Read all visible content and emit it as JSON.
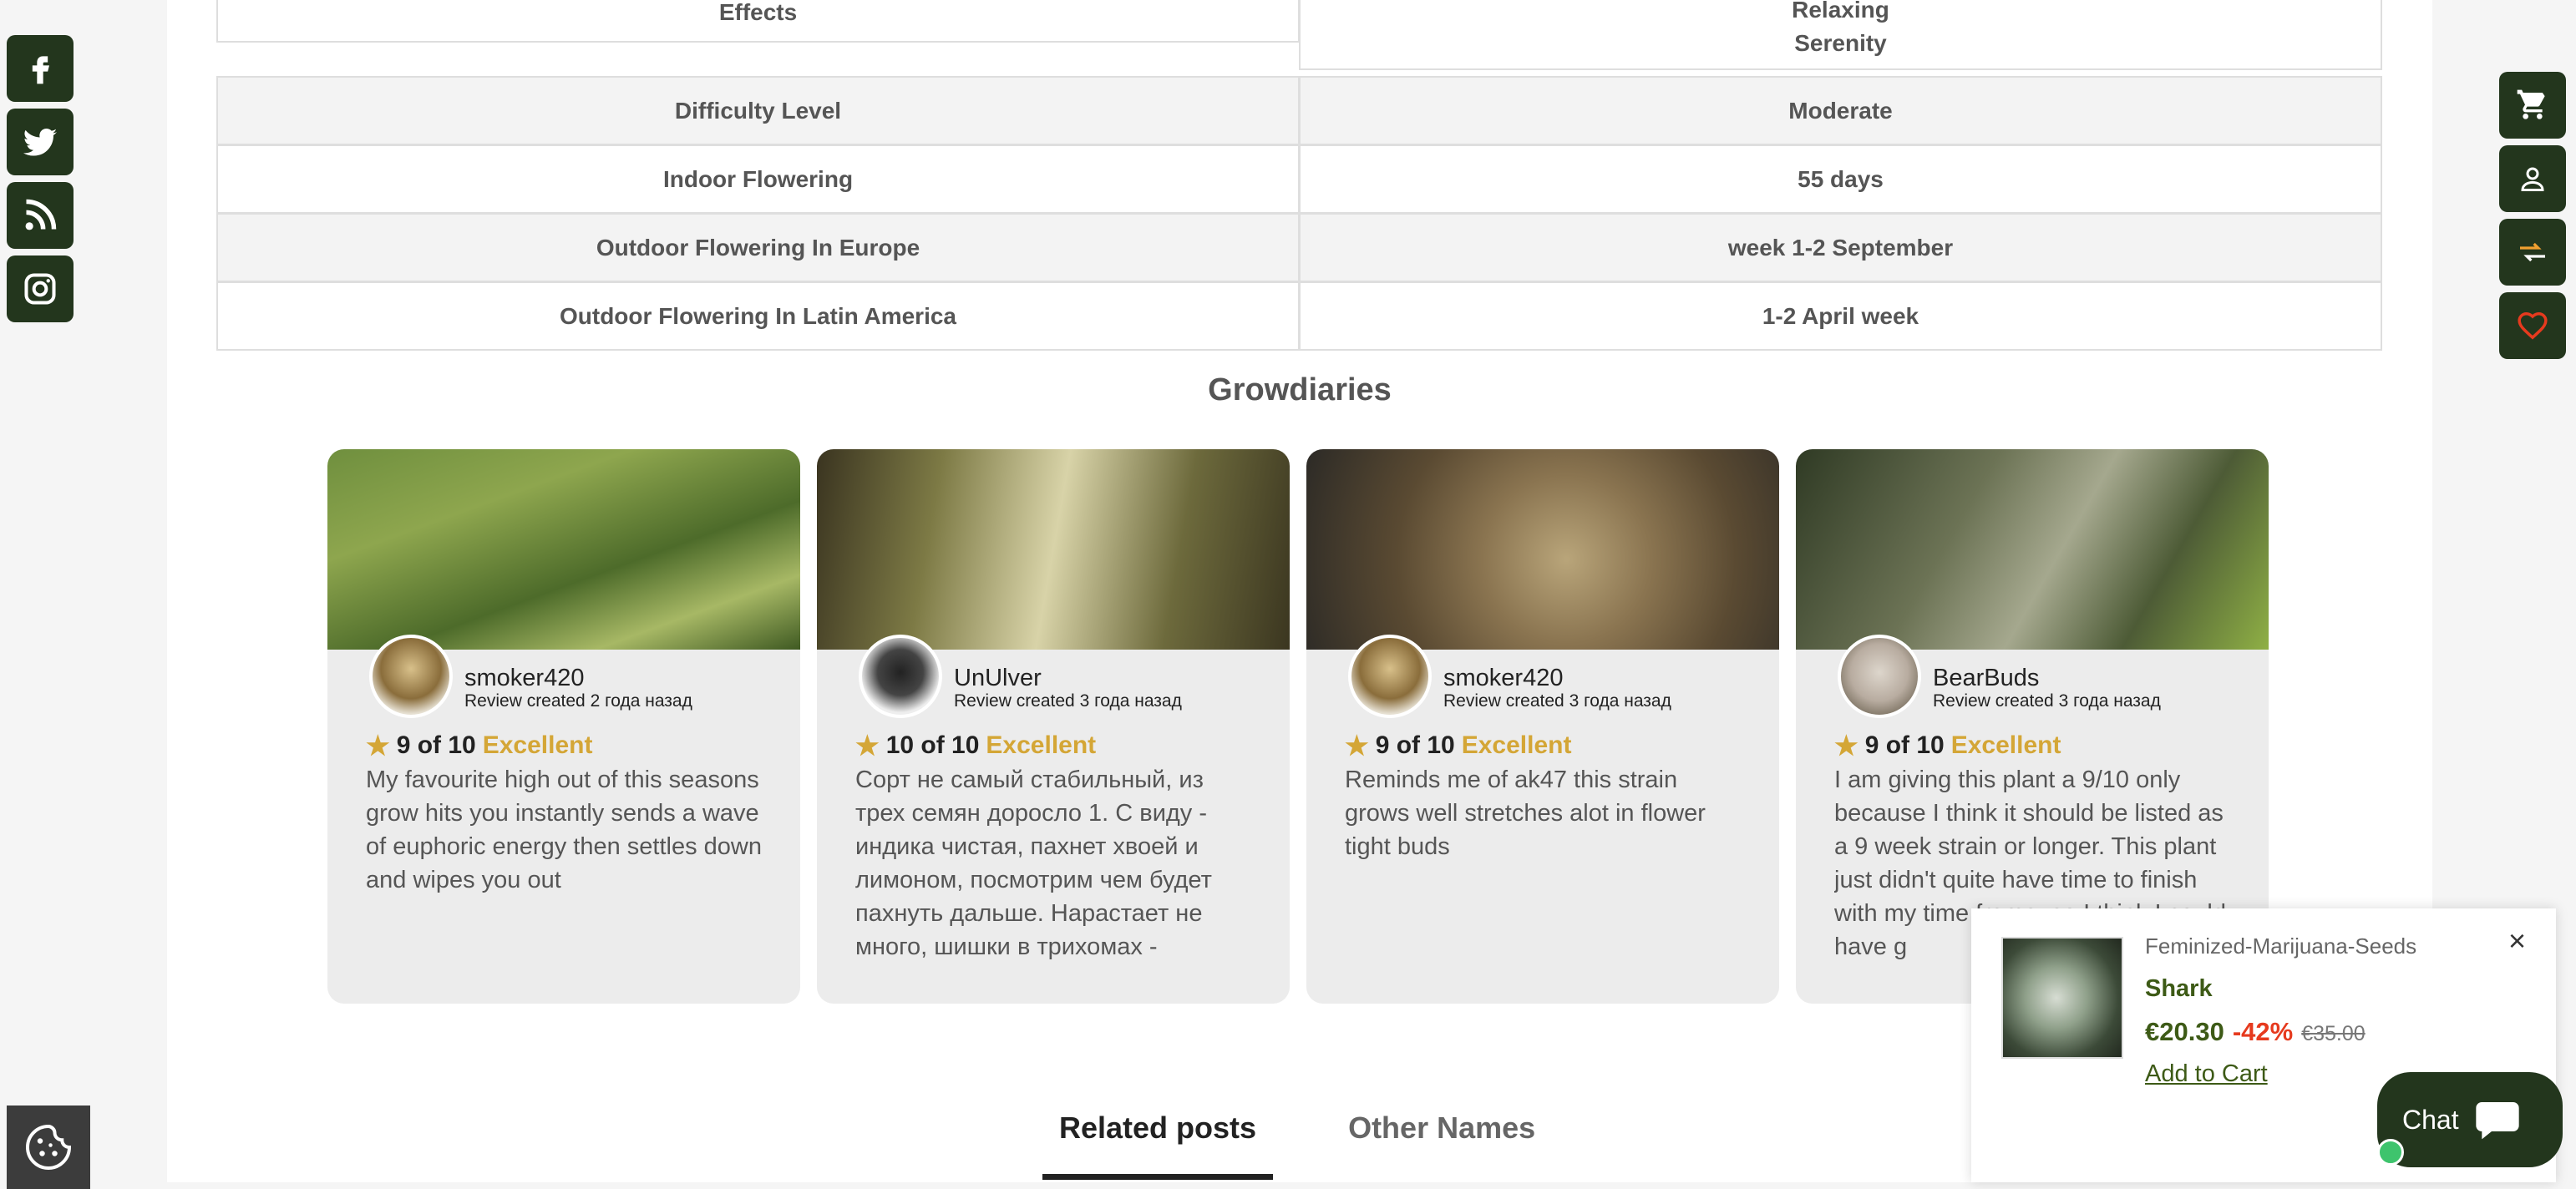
{
  "specs": {
    "effects": {
      "label": "Effects",
      "values": [
        "Relaxing",
        "Serenity"
      ]
    },
    "rows": [
      {
        "label": "Difficulty Level",
        "value": "Moderate"
      },
      {
        "label": "Indoor Flowering",
        "value": "55 days"
      },
      {
        "label": "Outdoor Flowering In Europe",
        "value": "week 1-2 September"
      },
      {
        "label": "Outdoor Flowering In Latin America",
        "value": "1-2 April week"
      }
    ]
  },
  "growdiaries": {
    "title": "Growdiaries",
    "cards": [
      {
        "user": "smoker420",
        "date": "Review created 2 года назад",
        "score": "9 of 10",
        "rating_word": "Excellent",
        "text": "My favourite high out of this seasons grow hits you instantly sends a wave of euphoric energy then settles down and wipes you out"
      },
      {
        "user": "UnUlver",
        "date": "Review created 3 года назад",
        "score": "10 of 10",
        "rating_word": "Excellent",
        "text": "Сорт не самый стабильный, из трех семян доросло 1. С виду - индика чистая, пахнет хвоей и лимоном, посмотрим чем будет пахнуть дальше. Нарастает не много, шишки в трихомах -"
      },
      {
        "user": "smoker420",
        "date": "Review created 3 года назад",
        "score": "9 of 10",
        "rating_word": "Excellent",
        "text": "Reminds me of ak47 this strain grows well stretches alot in flower tight buds"
      },
      {
        "user": "BearBuds",
        "date": "Review created 3 года назад",
        "score": "9 of 10",
        "rating_word": "Excellent",
        "text": "I am giving this plant a 9/10 only because I think it should be listed as a 9 week strain or longer. This plant just didn't quite have time to finish with my time frame, so I think I could have g"
      }
    ]
  },
  "tabs": {
    "related": "Related posts",
    "other": "Other Names"
  },
  "popup": {
    "category": "Feminized-Marijuana-Seeds",
    "name": "Shark",
    "price": "€20.30",
    "discount": "-42%",
    "old_price": "€35.00",
    "add_to_cart": "Add to Cart",
    "close": "×"
  },
  "chat": {
    "label": "Chat"
  },
  "colors": {
    "brand": "#23361d",
    "accent": "#d4a636",
    "discount": "#e63a1e",
    "price": "#3d5a16"
  },
  "icons": {
    "social": [
      "facebook-icon",
      "twitter-icon",
      "rss-icon",
      "instagram-icon"
    ],
    "tools": [
      "cart-icon",
      "user-icon",
      "compare-icon",
      "heart-icon"
    ]
  }
}
